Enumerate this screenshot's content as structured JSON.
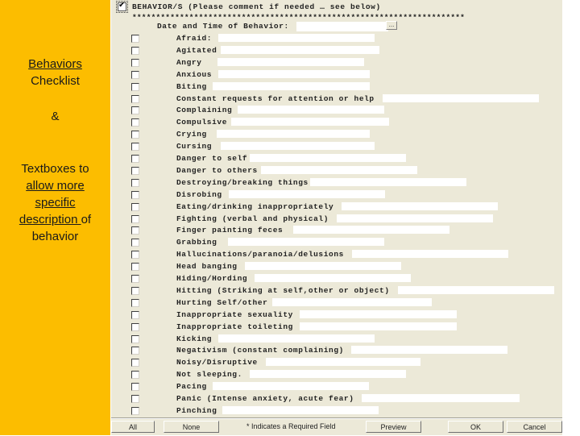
{
  "sidebar": {
    "line1": "Behaviors",
    "line2": "Checklist",
    "amp": "&",
    "line3": "Textboxes to",
    "line4": "allow more",
    "line5": "specific",
    "line6a": "description ",
    "line6b": "of",
    "line7": "behavior",
    "background": "#fcbd00"
  },
  "form": {
    "header_checked": true,
    "header_title": "BEHAVIOR/S (Please comment if needed … see below)",
    "stars": "**********************************************************************",
    "date_label": "Date and Time of Behavior:",
    "date_value": "",
    "date_button": "...",
    "items": [
      {
        "label": "Afraid:",
        "checked": false,
        "value": ""
      },
      {
        "label": "Agitated",
        "checked": false,
        "value": ""
      },
      {
        "label": "Angry",
        "checked": false,
        "value": ""
      },
      {
        "label": "Anxious",
        "checked": false,
        "value": ""
      },
      {
        "label": "Biting",
        "checked": false,
        "value": ""
      },
      {
        "label": "Constant requests for attention or help",
        "checked": false,
        "value": ""
      },
      {
        "label": "Complaining",
        "checked": false,
        "value": ""
      },
      {
        "label": "Compulsive",
        "checked": false,
        "value": ""
      },
      {
        "label": "Crying",
        "checked": false,
        "value": ""
      },
      {
        "label": "Cursing",
        "checked": false,
        "value": ""
      },
      {
        "label": "Danger to self",
        "checked": false,
        "value": ""
      },
      {
        "label": "Danger to others",
        "checked": false,
        "value": ""
      },
      {
        "label": "Destroying/breaking things",
        "checked": false,
        "value": ""
      },
      {
        "label": "Disrobing",
        "checked": false,
        "value": ""
      },
      {
        "label": "Eating/drinking inappropriately",
        "checked": false,
        "value": ""
      },
      {
        "label": "Fighting (verbal and physical)",
        "checked": false,
        "value": ""
      },
      {
        "label": "Finger painting feces",
        "checked": false,
        "value": ""
      },
      {
        "label": "Grabbing",
        "checked": false,
        "value": ""
      },
      {
        "label": "Hallucinations/paranoia/delusions",
        "checked": false,
        "value": ""
      },
      {
        "label": "Head banging",
        "checked": false,
        "value": ""
      },
      {
        "label": "Hiding/Hording",
        "checked": false,
        "value": ""
      },
      {
        "label": "Hitting (Striking at self,other or object)",
        "checked": false,
        "value": ""
      },
      {
        "label": "Hurting Self/other",
        "checked": false,
        "value": ""
      },
      {
        "label": "Inappropriate sexuality",
        "checked": false,
        "value": ""
      },
      {
        "label": "Inappropriate toileting",
        "checked": false,
        "value": ""
      },
      {
        "label": "Kicking",
        "checked": false,
        "value": ""
      },
      {
        "label": "Negativism (constant complaining)",
        "checked": false,
        "value": ""
      },
      {
        "label": "Noisy/Disruptive",
        "checked": false,
        "value": ""
      },
      {
        "label": "Not sleeping.",
        "checked": false,
        "value": ""
      },
      {
        "label": "Pacing",
        "checked": false,
        "value": ""
      },
      {
        "label": "Panic (Intense anxiety, acute fear)",
        "checked": false,
        "value": ""
      },
      {
        "label": "Pinching",
        "checked": false,
        "value": ""
      }
    ]
  },
  "buttons": {
    "all": "All",
    "none": "None",
    "required_note": "* Indicates a Required Field",
    "preview": "Preview",
    "ok": "OK",
    "cancel": "Cancel"
  }
}
